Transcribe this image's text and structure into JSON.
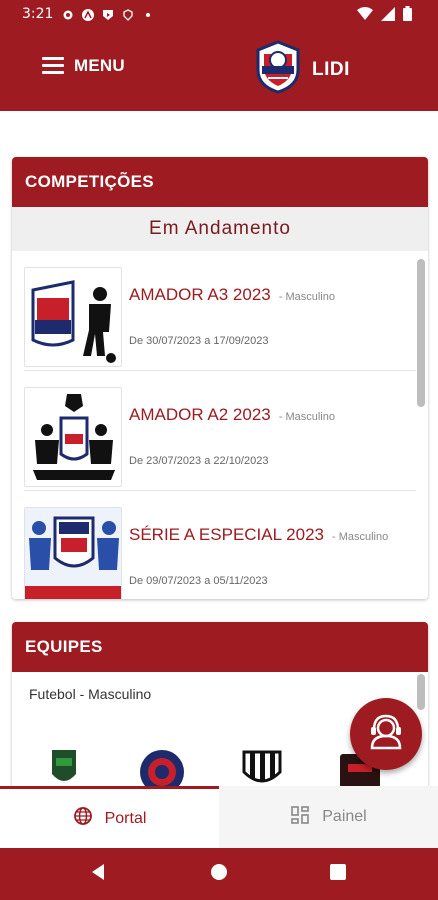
{
  "status_bar": {
    "time": "3:21"
  },
  "app_bar": {
    "menu_label": "MENU",
    "brand": "LIDI"
  },
  "competitions": {
    "header": "COMPETIÇÕES",
    "section": "Em Andamento",
    "items": [
      {
        "title": "AMADOR A3 2023",
        "gender": "- Masculino",
        "dates": "De 30/07/2023 a 17/09/2023"
      },
      {
        "title": "AMADOR A2 2023",
        "gender": "- Masculino",
        "dates": "De 23/07/2023 a 22/10/2023"
      },
      {
        "title": "SÉRIE A ESPECIAL 2023",
        "gender": "- Masculino",
        "dates": "De 09/07/2023 a 05/11/2023"
      }
    ]
  },
  "teams": {
    "header": "EQUIPES",
    "subtitle": "Futebol - Masculino"
  },
  "tabs": {
    "portal": "Portal",
    "painel": "Painel"
  },
  "colors": {
    "primary": "#9e1b22",
    "background": "#ffffff",
    "muted": "#888888"
  }
}
